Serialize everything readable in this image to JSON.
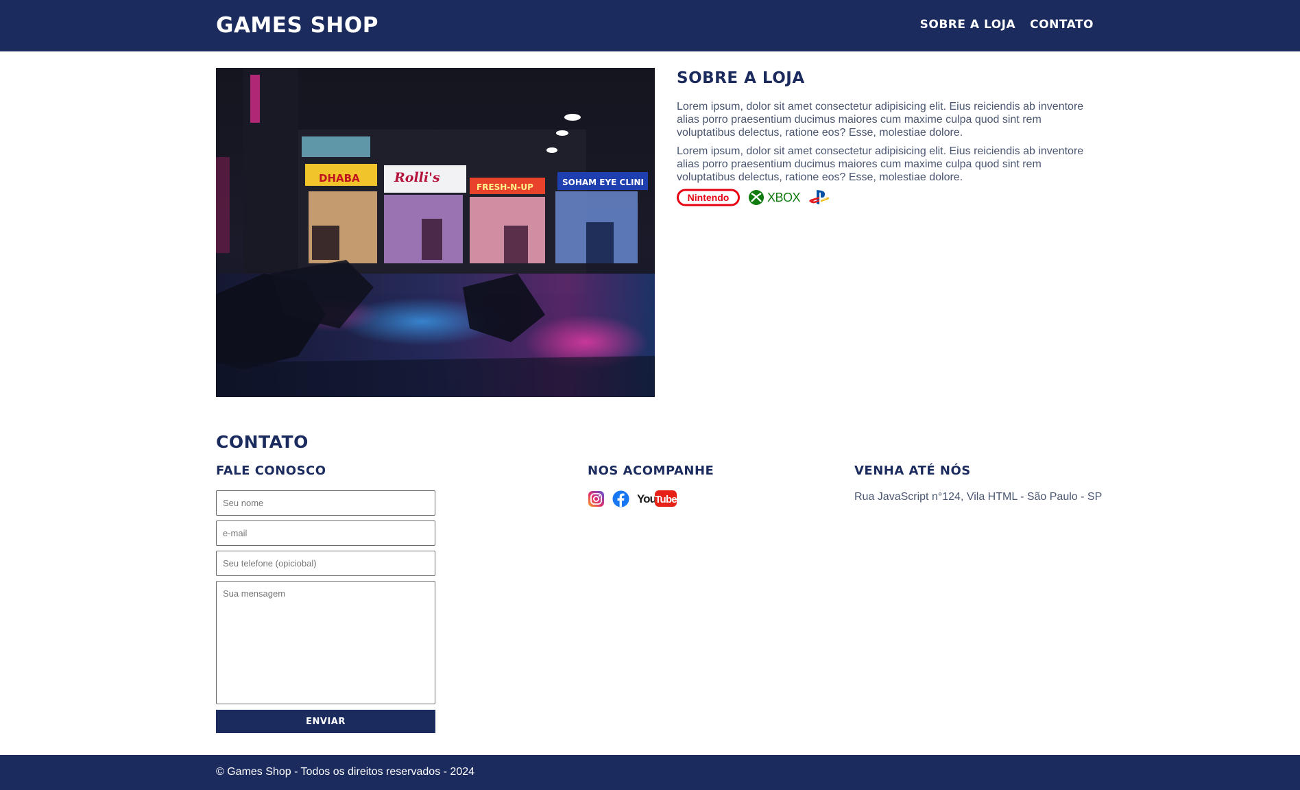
{
  "header": {
    "logo": "GAMES SHOP",
    "nav": [
      "SOBRE A LOJA",
      "CONTATO"
    ]
  },
  "about": {
    "title": "SOBRE A LOJA",
    "paragraphs": [
      "Lorem ipsum, dolor sit amet consectetur adipisicing elit. Eius reiciendis ab inventore alias porro praesentium ducimus maiores cum maxime culpa quod sint rem voluptatibus delectus, ratione eos? Esse, molestiae dolore.",
      "Lorem ipsum, dolor sit amet consectetur adipisicing elit. Eius reiciendis ab inventore alias porro praesentium ducimus maiores cum maxime culpa quod sint rem voluptatibus delectus, ratione eos? Esse, molestiae dolore."
    ],
    "brands": {
      "nintendo": "Nintendo",
      "xbox": "XBOX"
    },
    "store_signs": [
      "DHABA",
      "Rolli's",
      "FRESH-N-UP",
      "SOHAM EYE CLINI"
    ]
  },
  "contact": {
    "title": "CONTATO",
    "form": {
      "title": "FALE CONOSCO",
      "name_placeholder": "Seu nome",
      "email_placeholder": "e-mail",
      "phone_placeholder": "Seu telefone (opiciobal)",
      "message_placeholder": "Sua mensagem",
      "submit_label": "ENVIAR"
    },
    "social": {
      "title": "NOS ACOMPANHE",
      "youtube_you": "You",
      "youtube_tube": "Tube"
    },
    "location": {
      "title": "VENHA ATÉ NÓS",
      "address": "Rua JavaScript n°124, Vila HTML - São Paulo - SP"
    }
  },
  "footer": {
    "text": "© Games Shop - Todos os direitos reservados - 2024"
  },
  "colors": {
    "primary": "#1b2b5e",
    "text": "#4a5670",
    "nintendo": "#e60012",
    "xbox": "#107c10",
    "facebook": "#1877f2",
    "youtube": "#e62117"
  }
}
